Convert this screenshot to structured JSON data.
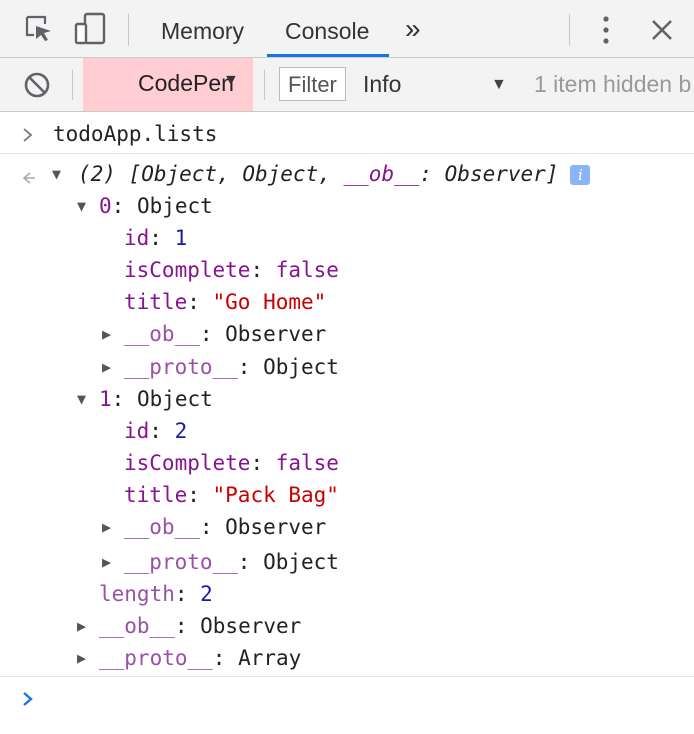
{
  "tabs": {
    "memory": "Memory",
    "console": "Console",
    "more": "»"
  },
  "toolbar": {
    "context": "CodePen",
    "filter_placeholder": "Filter",
    "levels": "Info",
    "hidden": "1 item hidden b"
  },
  "console": {
    "input": "todoApp.lists",
    "summary_prefix": "(2) [Object, Object, ",
    "summary_ob": "__ob__",
    "summary_suffix": ": Observer]",
    "info_badge": "i",
    "item0_key": "0",
    "item0_type": ": Object",
    "item0_id_key": "id",
    "item0_id_val": "1",
    "item0_complete_key": "isComplete",
    "item0_complete_val": "false",
    "item0_title_key": "title",
    "item0_title_val": "\"Go Home\"",
    "item0_ob_key": "__ob__",
    "item0_ob_val": ": Observer",
    "item0_proto_key": "__proto__",
    "item0_proto_val": ": Object",
    "item1_key": "1",
    "item1_type": ": Object",
    "item1_id_key": "id",
    "item1_id_val": "2",
    "item1_complete_key": "isComplete",
    "item1_complete_val": "false",
    "item1_title_key": "title",
    "item1_title_val": "\"Pack Bag\"",
    "item1_ob_key": "__ob__",
    "item1_ob_val": ": Observer",
    "item1_proto_key": "__proto__",
    "item1_proto_val": ": Object",
    "length_key": "length",
    "length_val": "2",
    "arr_ob_key": "__ob__",
    "arr_ob_val": ": Observer",
    "arr_proto_key": "__proto__",
    "arr_proto_val": ": Array"
  },
  "colors": {
    "accent": "#1a73e8",
    "context_bg": "#ffcdd2",
    "property_key": "#881391",
    "number": "#1a1aa6",
    "string": "#c80000",
    "prompt": "#1a73e8"
  },
  "icons": {
    "inspect": "inspect-element-icon",
    "device": "device-toolbar-icon",
    "menu": "kebab-menu-icon",
    "close": "close-icon",
    "clear": "clear-console-icon"
  }
}
